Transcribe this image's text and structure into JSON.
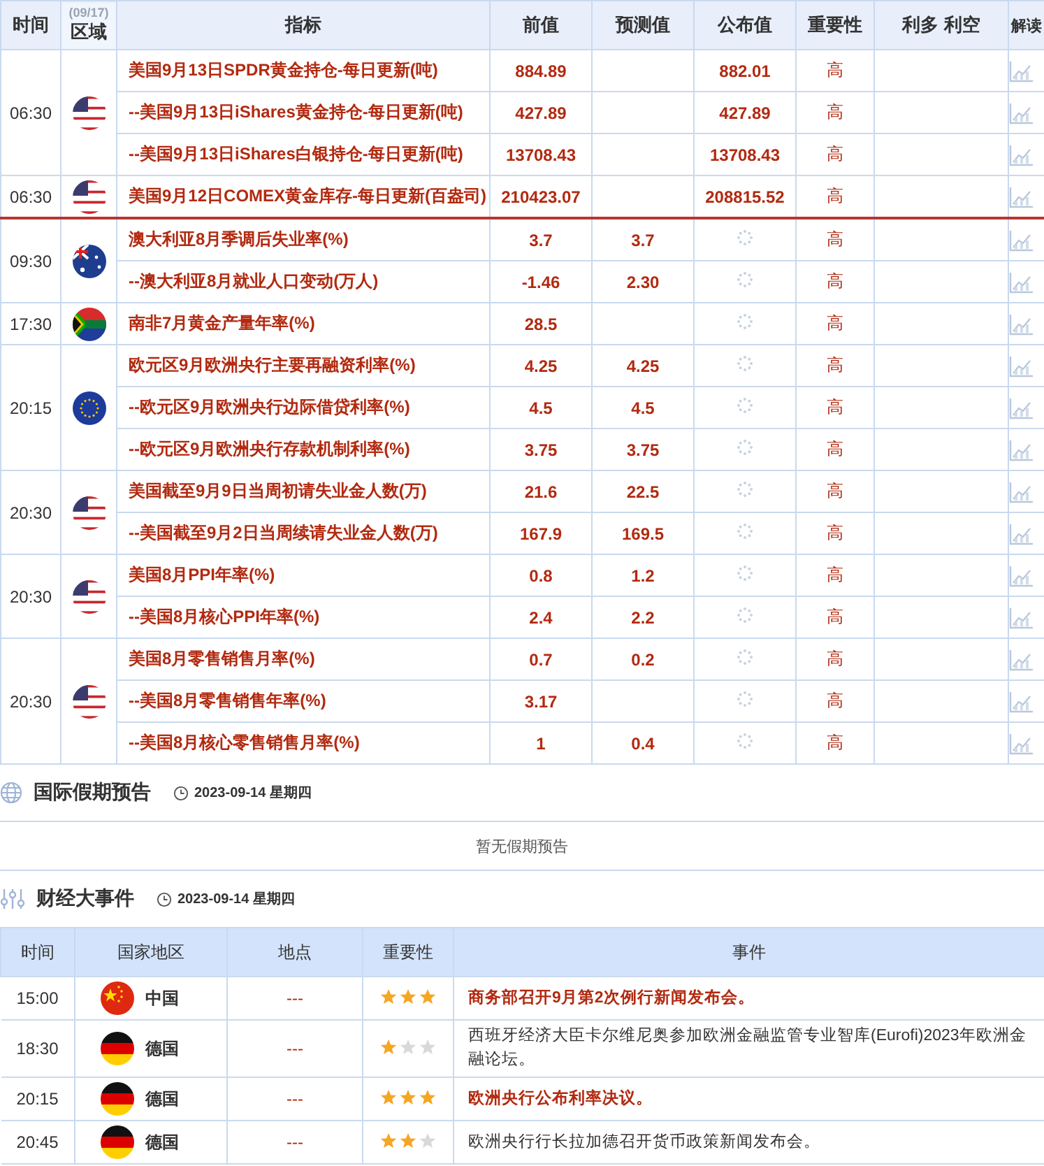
{
  "date_tab": "(09/17)",
  "columns": [
    "时间",
    "区域",
    "指标",
    "前值",
    "预测值",
    "公布值",
    "重要性",
    "利多 利空",
    "解读"
  ],
  "groups": [
    {
      "time": "06:30",
      "flag": {
        "kind": "us"
      },
      "now_marker": false,
      "rows": [
        {
          "indicator": "美国9月13日SPDR黄金持仓-每日更新(吨)",
          "previous": "884.89",
          "forecast": "",
          "actual": "882.01",
          "pending": false,
          "importance": "高"
        },
        {
          "indicator": "--美国9月13日iShares黄金持仓-每日更新(吨)",
          "previous": "427.89",
          "forecast": "",
          "actual": "427.89",
          "pending": false,
          "importance": "高"
        },
        {
          "indicator": "--美国9月13日iShares白银持仓-每日更新(吨)",
          "previous": "13708.43",
          "forecast": "",
          "actual": "13708.43",
          "pending": false,
          "importance": "高"
        }
      ]
    },
    {
      "time": "06:30",
      "flag": {
        "kind": "us"
      },
      "now_marker": true,
      "rows": [
        {
          "indicator": "美国9月12日COMEX黄金库存-每日更新(百盎司)",
          "previous": "210423.07",
          "forecast": "",
          "actual": "208815.52",
          "pending": false,
          "importance": "高"
        }
      ]
    },
    {
      "time": "09:30",
      "flag": {
        "kind": "au"
      },
      "now_marker": false,
      "rows": [
        {
          "indicator": "澳大利亚8月季调后失业率(%)",
          "previous": "3.7",
          "forecast": "3.7",
          "actual": "",
          "pending": true,
          "importance": "高"
        },
        {
          "indicator": "--澳大利亚8月就业人口变动(万人)",
          "previous": "-1.46",
          "forecast": "2.30",
          "actual": "",
          "pending": true,
          "importance": "高"
        }
      ]
    },
    {
      "time": "17:30",
      "flag": {
        "kind": "za"
      },
      "now_marker": false,
      "rows": [
        {
          "indicator": "南非7月黄金产量年率(%)",
          "previous": "28.5",
          "forecast": "",
          "actual": "",
          "pending": true,
          "importance": "高"
        }
      ]
    },
    {
      "time": "20:15",
      "flag": {
        "kind": "eu"
      },
      "now_marker": false,
      "rows": [
        {
          "indicator": "欧元区9月欧洲央行主要再融资利率(%)",
          "previous": "4.25",
          "forecast": "4.25",
          "actual": "",
          "pending": true,
          "importance": "高"
        },
        {
          "indicator": "--欧元区9月欧洲央行边际借贷利率(%)",
          "previous": "4.5",
          "forecast": "4.5",
          "actual": "",
          "pending": true,
          "importance": "高"
        },
        {
          "indicator": "--欧元区9月欧洲央行存款机制利率(%)",
          "previous": "3.75",
          "forecast": "3.75",
          "actual": "",
          "pending": true,
          "importance": "高"
        }
      ]
    },
    {
      "time": "20:30",
      "flag": {
        "kind": "us"
      },
      "now_marker": false,
      "rows": [
        {
          "indicator": "美国截至9月9日当周初请失业金人数(万)",
          "previous": "21.6",
          "forecast": "22.5",
          "actual": "",
          "pending": true,
          "importance": "高"
        },
        {
          "indicator": "--美国截至9月2日当周续请失业金人数(万)",
          "previous": "167.9",
          "forecast": "169.5",
          "actual": "",
          "pending": true,
          "importance": "高"
        }
      ]
    },
    {
      "time": "20:30",
      "flag": {
        "kind": "us"
      },
      "now_marker": false,
      "rows": [
        {
          "indicator": "美国8月PPI年率(%)",
          "previous": "0.8",
          "forecast": "1.2",
          "actual": "",
          "pending": true,
          "importance": "高"
        },
        {
          "indicator": "--美国8月核心PPI年率(%)",
          "previous": "2.4",
          "forecast": "2.2",
          "actual": "",
          "pending": true,
          "importance": "高"
        }
      ]
    },
    {
      "time": "20:30",
      "flag": {
        "kind": "us"
      },
      "now_marker": false,
      "rows": [
        {
          "indicator": "美国8月零售销售月率(%)",
          "previous": "0.7",
          "forecast": "0.2",
          "actual": "",
          "pending": true,
          "importance": "高"
        },
        {
          "indicator": "--美国8月零售销售年率(%)",
          "previous": "3.17",
          "forecast": "",
          "actual": "",
          "pending": true,
          "importance": "高"
        },
        {
          "indicator": "--美国8月核心零售销售月率(%)",
          "previous": "1",
          "forecast": "0.4",
          "actual": "",
          "pending": true,
          "importance": "高"
        }
      ]
    }
  ],
  "holidays": {
    "title": "国际假期预告",
    "date": "2023-09-14 星期四",
    "empty_text": "暂无假期预告"
  },
  "events": {
    "title": "财经大事件",
    "date": "2023-09-14 星期四",
    "columns": [
      "时间",
      "国家地区",
      "地点",
      "重要性",
      "事件"
    ],
    "rows": [
      {
        "time": "15:00",
        "flag": {
          "kind": "cn"
        },
        "country": "中国",
        "place": "---",
        "stars": 3,
        "highlight": true,
        "event": "商务部召开9月第2次例行新闻发布会。"
      },
      {
        "time": "18:30",
        "flag": {
          "kind": "de"
        },
        "country": "德国",
        "place": "---",
        "stars": 1,
        "highlight": false,
        "event": "西班牙经济大臣卡尔维尼奥参加欧洲金融监管专业智库(Eurofi)2023年欧洲金融论坛。"
      },
      {
        "time": "20:15",
        "flag": {
          "kind": "de"
        },
        "country": "德国",
        "place": "---",
        "stars": 3,
        "highlight": true,
        "event": "欧洲央行公布利率决议。"
      },
      {
        "time": "20:45",
        "flag": {
          "kind": "de"
        },
        "country": "德国",
        "place": "---",
        "stars": 2,
        "highlight": false,
        "event": "欧洲央行行长拉加德召开货币政策新闻发布会。"
      }
    ]
  }
}
